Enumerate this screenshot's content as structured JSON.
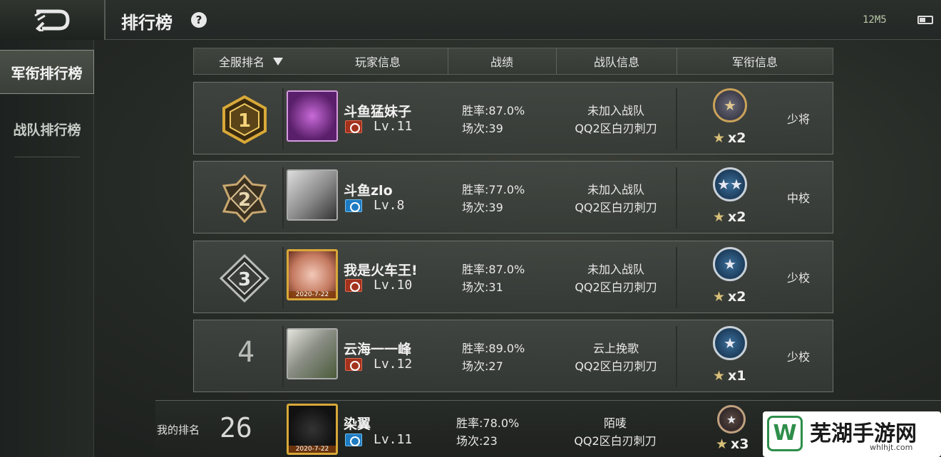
{
  "header": {
    "title": "排行榜",
    "help_icon": "?",
    "signal": "12M5",
    "battery_icon": "battery-icon"
  },
  "sidebar": {
    "items": [
      {
        "label": "军衔排行榜",
        "active": true
      },
      {
        "label": "战队排行榜",
        "active": false
      }
    ]
  },
  "table": {
    "columns": [
      "全服排名",
      "玩家信息",
      "战绩",
      "战队信息",
      "军衔信息"
    ],
    "rows": [
      {
        "rank": "1",
        "name": "斗鱼猛妹子",
        "level": "Lv.11",
        "badge": "red",
        "avatar": "purple",
        "date": "",
        "win_rate": "胜率:87.0%",
        "matches": "场次:39",
        "team": "未加入战队",
        "server": "QQ2区白刃刺刀",
        "medal": "gold",
        "medal_icon": "★",
        "stars": "x2",
        "rank_title": "少将"
      },
      {
        "rank": "2",
        "name": "斗鱼zlo",
        "level": "Lv.8",
        "badge": "blue",
        "avatar": "gray",
        "date": "",
        "win_rate": "胜率:77.0%",
        "matches": "场次:39",
        "team": "未加入战队",
        "server": "QQ2区白刃刺刀",
        "medal": "blue",
        "medal_icon": "★★",
        "stars": "x2",
        "rank_title": "中校"
      },
      {
        "rank": "3",
        "name": "我是火车王!",
        "level": "Lv.10",
        "badge": "red",
        "avatar": "gold",
        "date": "2020-7-22",
        "win_rate": "胜率:87.0%",
        "matches": "场次:31",
        "team": "未加入战队",
        "server": "QQ2区白刃刺刀",
        "medal": "blue",
        "medal_icon": "★",
        "stars": "x2",
        "rank_title": "少校"
      },
      {
        "rank": "4",
        "name": "云海一一峰",
        "level": "Lv.12",
        "badge": "red",
        "avatar": "photo",
        "date": "",
        "win_rate": "胜率:89.0%",
        "matches": "场次:27",
        "team": "云上挽歌",
        "server": "QQ2区白刃刺刀",
        "medal": "blue",
        "medal_icon": "★",
        "stars": "x1",
        "rank_title": "少校"
      }
    ]
  },
  "my_rank": {
    "label": "我的排名",
    "rank": "26",
    "name": "染翼",
    "level": "Lv.11",
    "date": "2020-7-22",
    "win_rate": "胜率:78.0%",
    "matches": "场次:23",
    "team": "陌唛",
    "server": "QQ2区白刃刺刀",
    "medal_icon": "★",
    "stars": "x3"
  },
  "watermark": {
    "logo": "W",
    "text": "芜湖手游网",
    "url": "whlhjt.com"
  }
}
